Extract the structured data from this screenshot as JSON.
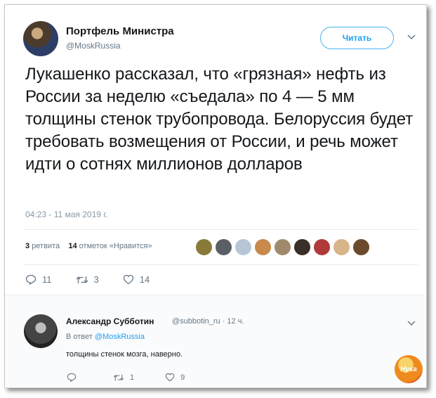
{
  "tweet": {
    "author_name": "Портфель Министра",
    "author_handle": "@MoskRussia",
    "follow_label": "Читать",
    "text": "Лукашенко рассказал, что «грязная» нефть из России за неделю «съедала» по 4 — 5 мм толщины стенок трубопровода. Белоруссия будет требовать возмещения от России, и речь может идти о сотнях миллионов долларов",
    "timestamp": "04:23 - 11 мая 2019 г.",
    "retweets_count": "3",
    "retweets_label": "ретвита",
    "likes_count": "14",
    "likes_label": "отметок «Нравится»",
    "actions": {
      "reply_count": "11",
      "retweet_count": "3",
      "like_count": "14"
    }
  },
  "reply": {
    "author_name": "Александр Субботин",
    "author_handle": "@subbotin_ru · 12 ч.",
    "in_reply_prefix": "В ответ",
    "in_reply_handle": "@MoskRussia",
    "text": "толщины стенок мозга, наверно.",
    "actions": {
      "retweet_count": "1",
      "like_count": "9"
    }
  },
  "watermark": {
    "text": "Нука"
  },
  "colors": {
    "accent": "#1da1f2",
    "text": "#14171a",
    "muted": "#657786"
  }
}
